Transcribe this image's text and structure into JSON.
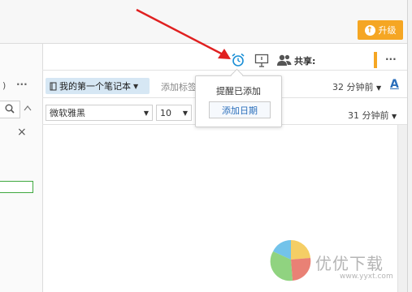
{
  "header": {
    "upgrade_label": "升级"
  },
  "toolbar": {
    "share_label": "共享:",
    "more_label": "···",
    "notebook_label": "我的第一个笔记本",
    "add_tag_label": "添加标签",
    "time_created": "32 分钟前",
    "text_style_label": "A",
    "font_family": "微软雅黑",
    "font_size": "10",
    "time_modified": "31 分钟前"
  },
  "reminder_popup": {
    "title": "提醒已添加",
    "add_date_label": "添加日期"
  },
  "left_panel": {
    "more_label": "···",
    "paren_label": ")",
    "close_label": "×"
  },
  "watermark": {
    "text": "优优下载",
    "url": "www.yyxt.com"
  },
  "colors": {
    "accent_orange": "#f5a623",
    "arrow_red": "#e02020",
    "link_blue": "#2a6ebb",
    "alarm_blue": "#1a8fd6"
  },
  "icons": [
    "alarm-clock-icon",
    "presentation-icon",
    "people-icon",
    "notebook-icon",
    "search-icon",
    "chevron-up-icon",
    "close-icon"
  ]
}
